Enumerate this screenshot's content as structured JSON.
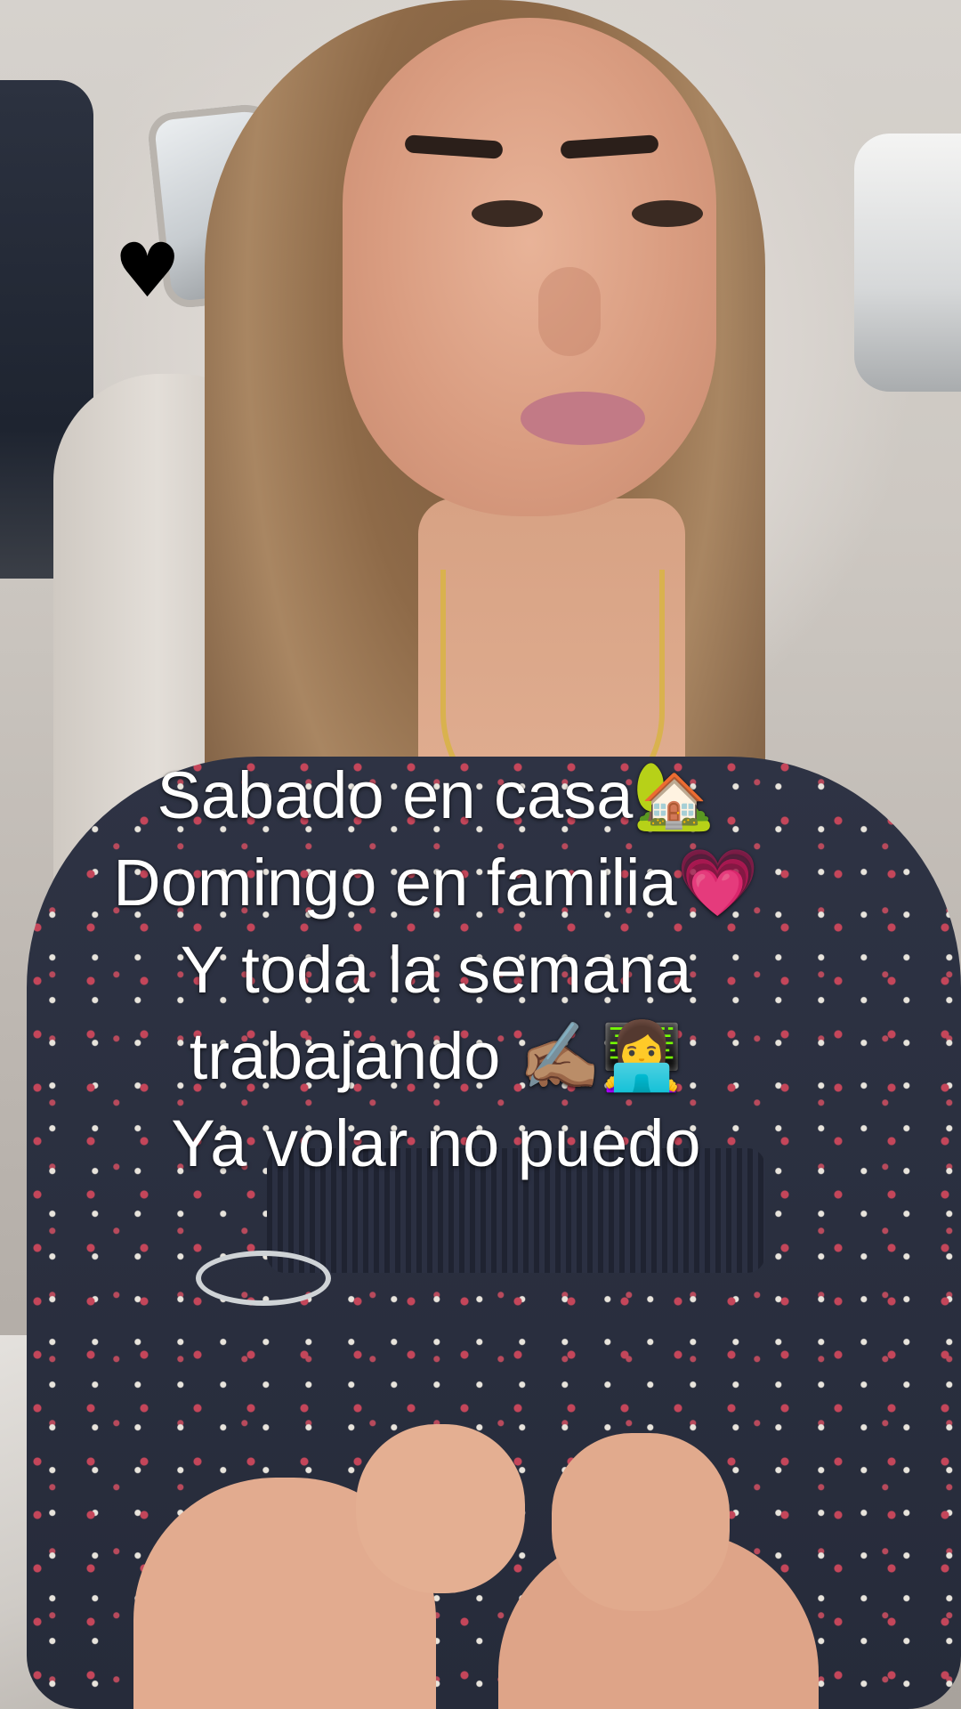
{
  "sticker": {
    "heart_glyph": "♥",
    "icon": "black-heart-icon",
    "color": "#000000"
  },
  "caption": {
    "lines": [
      {
        "text": "Sabado en casa",
        "emoji": "🏡"
      },
      {
        "text": "Domingo en familia",
        "emoji": "💗"
      },
      {
        "text": "Y toda la semana",
        "emoji": ""
      },
      {
        "text": "trabajando ",
        "emoji": "✍🏽👩‍💻"
      },
      {
        "text": "Ya volar no puedo",
        "emoji": ""
      }
    ],
    "color": "#ffffff"
  }
}
